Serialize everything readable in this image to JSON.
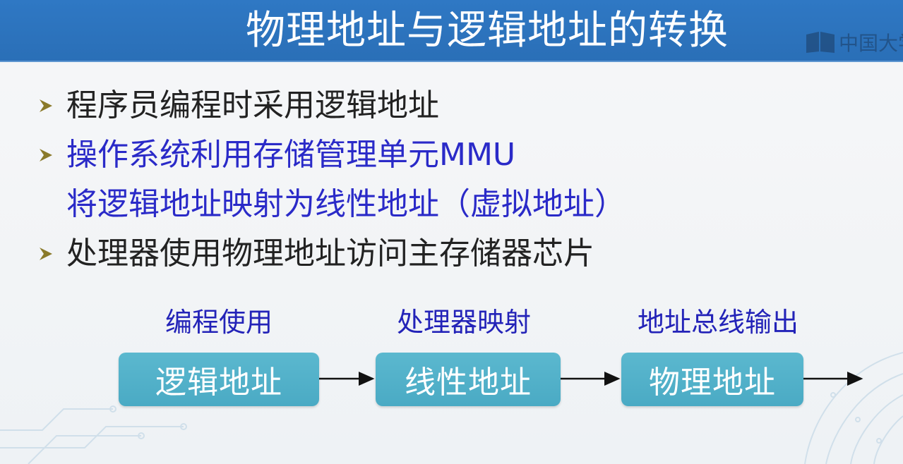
{
  "slide": {
    "title": "物理地址与逻辑地址的转换",
    "watermark": {
      "text": "中国大学",
      "icon": "book-icon"
    }
  },
  "bullets": [
    {
      "text": "程序员编程时采用逻辑地址",
      "color": "#222222"
    },
    {
      "text": "操作系统利用存储管理单元MMU",
      "color": "#2a2ac8"
    },
    {
      "text": "处理器使用物理地址访问主存储器芯片",
      "color": "#222222"
    }
  ],
  "bullet_continuation": "将逻辑地址映射为线性地址（虚拟地址）",
  "flow": {
    "stages": [
      {
        "label": "编程使用",
        "box": "逻辑地址"
      },
      {
        "label": "处理器映射",
        "box": "线性地址"
      },
      {
        "label": "地址总线输出",
        "box": "物理地址"
      }
    ]
  },
  "colors": {
    "title_bar": "#2f78c4",
    "box_fill": "#4aaac4",
    "label_blue": "#2323b8",
    "bullet_marker": "#8a7a2a"
  }
}
